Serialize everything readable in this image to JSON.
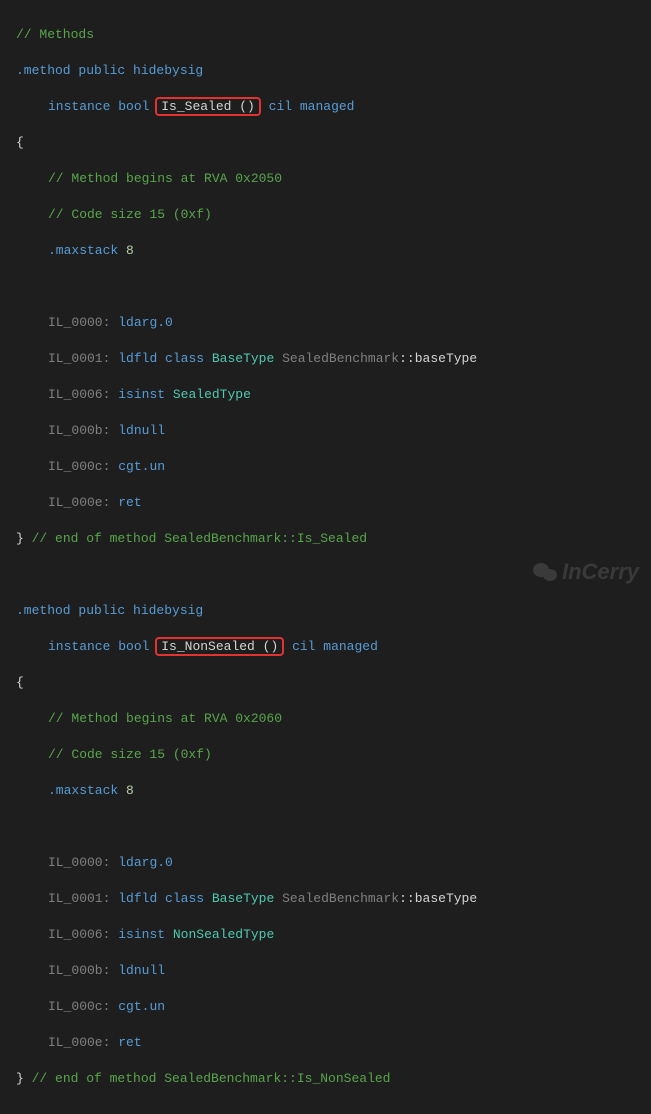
{
  "method1": {
    "header_comment": "// Methods",
    "decl_line1_prefix": ".method",
    "decl_line1_mods": " public hidebysig",
    "decl_line2_prefix": "instance ",
    "decl_line2_type": "bool ",
    "decl_line2_name": "Is_Sealed ()",
    "decl_line2_suffix": " cil managed",
    "open_brace": "{",
    "comment_rva": "// Method begins at RVA 0x2050",
    "comment_size": "// Code size 15 (0xf)",
    "maxstack": ".maxstack",
    "maxstack_val": " 8",
    "instr": [
      {
        "label": "IL_0000:",
        "sp": " ",
        "op": "ldarg.0",
        "rest": ""
      },
      {
        "label": "IL_0001:",
        "sp": " ",
        "op": "ldfld",
        "rest_pre": " class ",
        "rest_type": "BaseType",
        "rest_mid": " ",
        "rest_ns": "SealedBenchmark",
        "rest_sep": "::",
        "rest_field": "baseType"
      },
      {
        "label": "IL_0006:",
        "sp": " ",
        "op": "isinst",
        "rest_pre": " ",
        "rest_type": "SealedType"
      },
      {
        "label": "IL_000b:",
        "sp": " ",
        "op": "ldnull",
        "rest": ""
      },
      {
        "label": "IL_000c:",
        "sp": " ",
        "op": "cgt.un",
        "rest": ""
      },
      {
        "label": "IL_000e:",
        "sp": " ",
        "op": "ret",
        "rest": ""
      }
    ],
    "close_brace": "}",
    "end_comment": " // end of method SealedBenchmark::Is_Sealed"
  },
  "method2": {
    "decl_line1_prefix": ".method",
    "decl_line1_mods": " public hidebysig",
    "decl_line2_prefix": "instance ",
    "decl_line2_type": "bool ",
    "decl_line2_name": "Is_NonSealed ()",
    "decl_line2_suffix": " cil managed",
    "open_brace": "{",
    "comment_rva": "// Method begins at RVA 0x2060",
    "comment_size": "// Code size 15 (0xf)",
    "maxstack": ".maxstack",
    "maxstack_val": " 8",
    "instr": [
      {
        "label": "IL_0000:",
        "sp": " ",
        "op": "ldarg.0",
        "rest": ""
      },
      {
        "label": "IL_0001:",
        "sp": " ",
        "op": "ldfld",
        "rest_pre": " class ",
        "rest_type": "BaseType",
        "rest_mid": " ",
        "rest_ns": "SealedBenchmark",
        "rest_sep": "::",
        "rest_field": "baseType"
      },
      {
        "label": "IL_0006:",
        "sp": " ",
        "op": "isinst",
        "rest_pre": " ",
        "rest_type": "NonSealedType"
      },
      {
        "label": "IL_000b:",
        "sp": " ",
        "op": "ldnull",
        "rest": ""
      },
      {
        "label": "IL_000c:",
        "sp": " ",
        "op": "cgt.un",
        "rest": ""
      },
      {
        "label": "IL_000e:",
        "sp": " ",
        "op": "ret",
        "rest": ""
      }
    ],
    "close_brace": "}",
    "end_comment": " // end of method SealedBenchmark::Is_NonSealed"
  },
  "watermark": "InCerry"
}
